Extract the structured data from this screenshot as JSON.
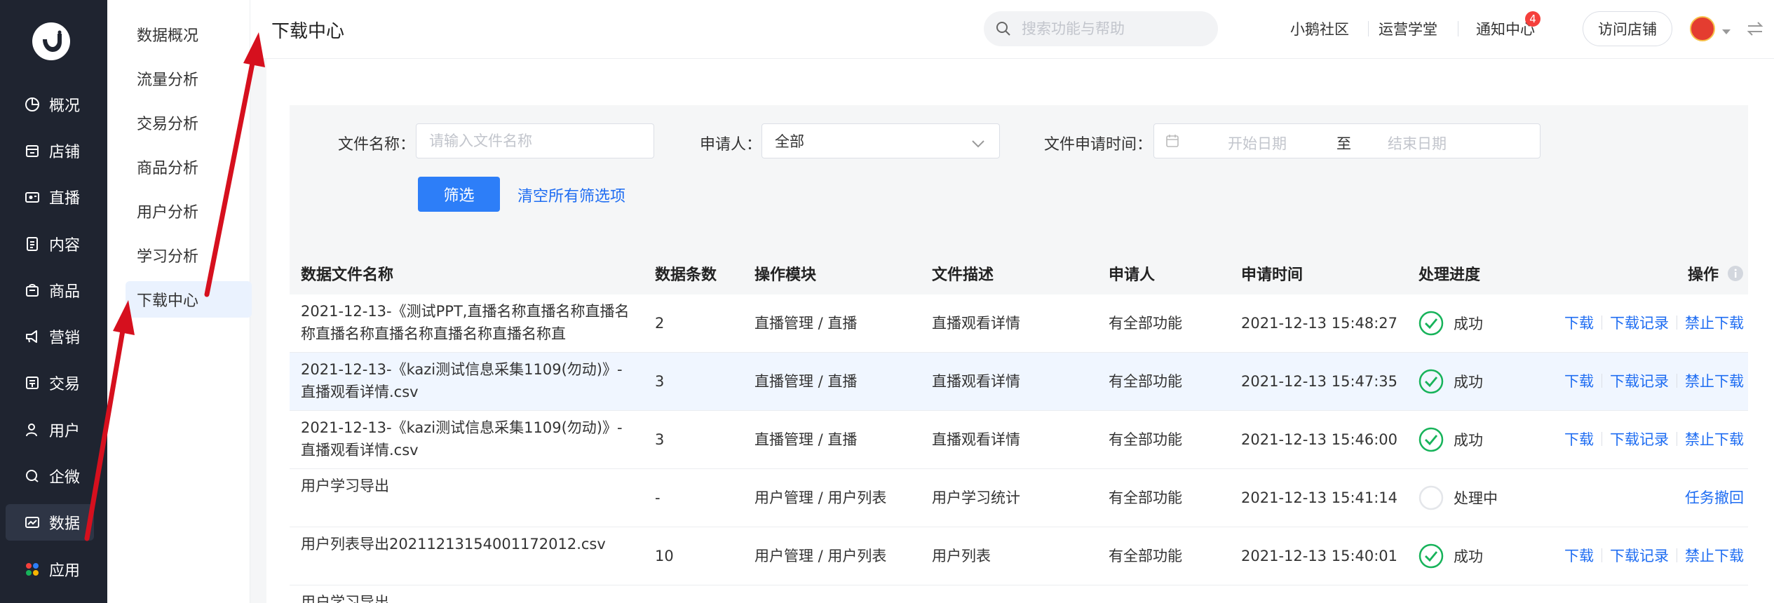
{
  "nav": {
    "items": [
      {
        "label": "概况",
        "icon": "overview-icon"
      },
      {
        "label": "店铺",
        "icon": "store-icon"
      },
      {
        "label": "直播",
        "icon": "live-icon"
      },
      {
        "label": "内容",
        "icon": "content-icon"
      },
      {
        "label": "商品",
        "icon": "goods-icon"
      },
      {
        "label": "营销",
        "icon": "marketing-icon"
      },
      {
        "label": "交易",
        "icon": "trade-icon"
      },
      {
        "label": "用户",
        "icon": "user-icon"
      },
      {
        "label": "企微",
        "icon": "wecom-icon"
      },
      {
        "label": "数据",
        "icon": "data-icon"
      },
      {
        "label": "应用",
        "icon": "apps-icon"
      }
    ]
  },
  "subnav": {
    "items": [
      {
        "label": "数据概况"
      },
      {
        "label": "流量分析"
      },
      {
        "label": "交易分析"
      },
      {
        "label": "商品分析"
      },
      {
        "label": "用户分析"
      },
      {
        "label": "学习分析"
      },
      {
        "label": "下载中心"
      }
    ]
  },
  "header": {
    "title": "下载中心",
    "search_placeholder": "搜索功能与帮助",
    "links": [
      "小鹅社区",
      "运营学堂",
      "通知中心"
    ],
    "notify_count": "4",
    "visit_store": "访问店铺"
  },
  "filter": {
    "file_name_label": "文件名称：",
    "file_name_placeholder": "请输入文件名称",
    "applicant_label": "申请人：",
    "applicant_value": "全部",
    "time_label": "文件申请时间：",
    "start_placeholder": "开始日期",
    "range_sep": "至",
    "end_placeholder": "结束日期",
    "filter_button": "筛选",
    "clear_link": "清空所有筛选项"
  },
  "table": {
    "columns": [
      "数据文件名称",
      "数据条数",
      "操作模块",
      "文件描述",
      "申请人",
      "申请时间",
      "处理进度",
      "操作"
    ],
    "rows": [
      {
        "name": "2021-12-13-《测试PPT,直播名称直播名称直播名称直播名称直播名称直播名称直播名称直",
        "count": "2",
        "module": "直播管理 / 直播",
        "desc": "直播观看详情",
        "applicant": "有全部功能",
        "time": "2021-12-13 15:48:27",
        "status": "成功",
        "ops": [
          "下载",
          "下载记录",
          "禁止下载"
        ]
      },
      {
        "name": "2021-12-13-《kazi测试信息采集1109(勿动)》-直播观看详情.csv",
        "count": "3",
        "module": "直播管理 / 直播",
        "desc": "直播观看详情",
        "applicant": "有全部功能",
        "time": "2021-12-13 15:47:35",
        "status": "成功",
        "ops": [
          "下载",
          "下载记录",
          "禁止下载"
        ]
      },
      {
        "name": "2021-12-13-《kazi测试信息采集1109(勿动)》-直播观看详情.csv",
        "count": "3",
        "module": "直播管理 / 直播",
        "desc": "直播观看详情",
        "applicant": "有全部功能",
        "time": "2021-12-13 15:46:00",
        "status": "成功",
        "ops": [
          "下载",
          "下载记录",
          "禁止下载"
        ]
      },
      {
        "name": "用户学习导出",
        "count": "-",
        "module": "用户管理 / 用户列表",
        "desc": "用户学习统计",
        "applicant": "有全部功能",
        "time": "2021-12-13 15:41:14",
        "status": "处理中",
        "ops": [
          "任务撤回"
        ]
      },
      {
        "name": "用户列表导出20211213154001172012.csv",
        "count": "10",
        "module": "用户管理 / 用户列表",
        "desc": "用户列表",
        "applicant": "有全部功能",
        "time": "2021-12-13 15:40:01",
        "status": "成功",
        "ops": [
          "下载",
          "下载记录",
          "禁止下载"
        ]
      },
      {
        "name": "用户学习导出",
        "count": "",
        "module": "",
        "desc": "",
        "applicant": "",
        "time": "",
        "status": "",
        "ops": []
      }
    ]
  },
  "colors": {
    "nav_bg": "#1f2430",
    "primary": "#2d7ef8",
    "link": "#1f6df2",
    "success": "#17b35a",
    "annotation_arrow": "#d6101e"
  }
}
